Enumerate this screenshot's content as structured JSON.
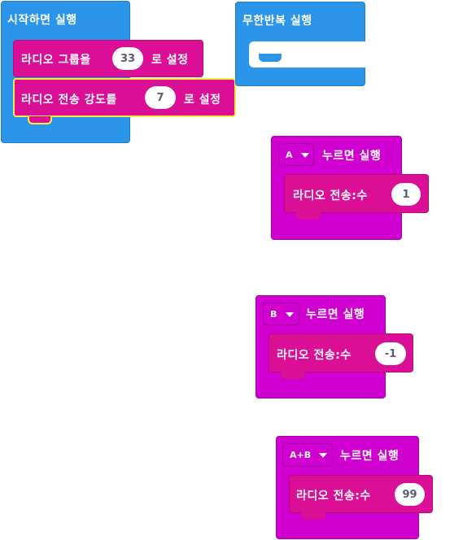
{
  "on_start": {
    "title": "시작하면 실행",
    "set_group": {
      "prefix": "라디오 그룹을",
      "value": "33",
      "suffix": "로 설정"
    },
    "set_power": {
      "prefix": "라디오 전송 강도를",
      "value": "7",
      "suffix": "로 설정"
    }
  },
  "forever": {
    "title": "무한반복 실행"
  },
  "on_button_a": {
    "button": "A",
    "title": "누르면 실행",
    "send": {
      "label": "라디오 전송:수",
      "value": "1"
    }
  },
  "on_button_b": {
    "button": "B",
    "title": "누르면 실행",
    "send": {
      "label": "라디오 전송:수",
      "value": "-1"
    }
  },
  "on_button_ab": {
    "button": "A+B",
    "title": "누르면 실행",
    "send": {
      "label": "라디오 전송:수",
      "value": "99"
    }
  },
  "colors": {
    "basic": "#2b95ea",
    "radio": "#db0f96",
    "input": "#d000d0",
    "selected_outline": "#ffeb3b"
  }
}
